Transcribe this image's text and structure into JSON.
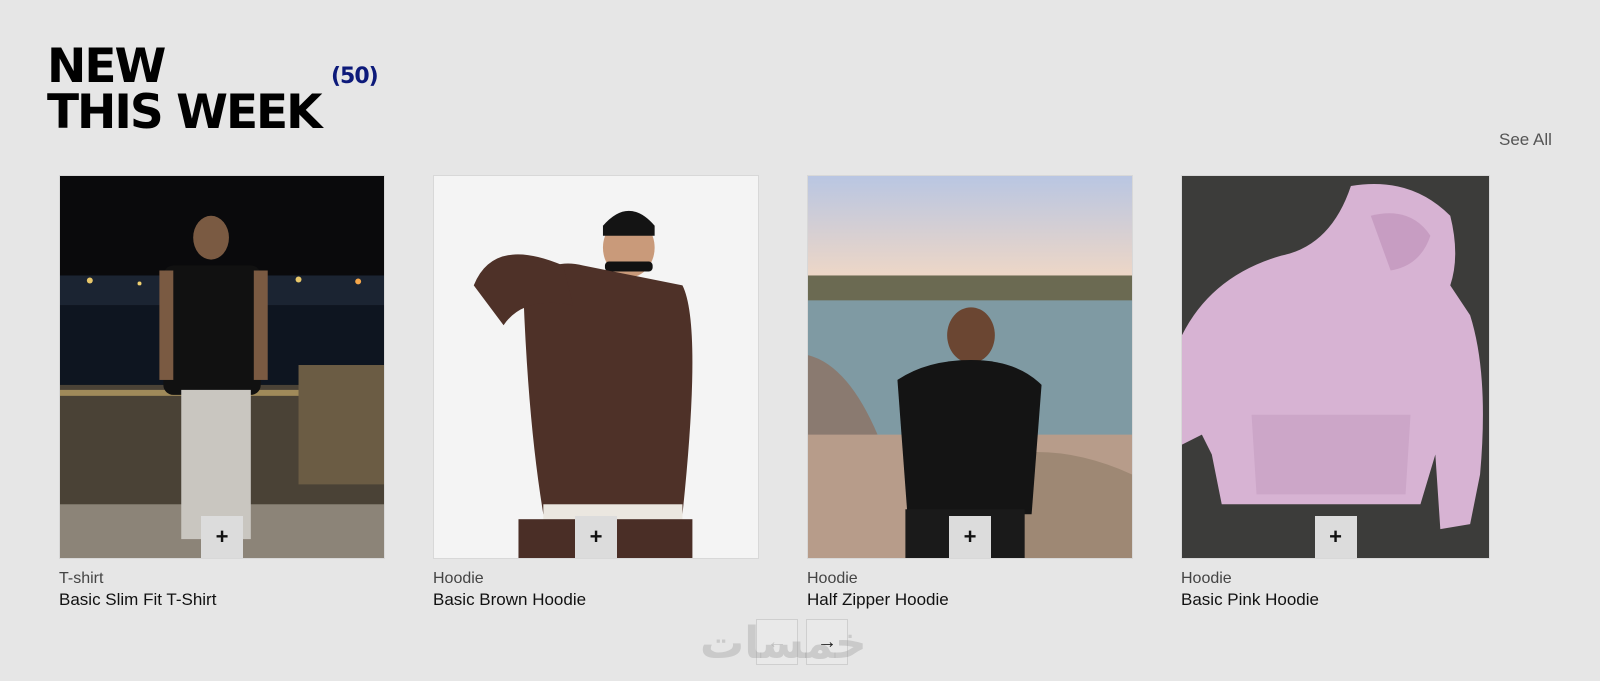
{
  "section": {
    "title_line1": "NEW",
    "title_line2": "THIS WEEK",
    "count": "(50)",
    "see_all": "See All"
  },
  "products": [
    {
      "category": "T-shirt",
      "name": "Basic Slim Fit T-Shirt",
      "add_label": "+"
    },
    {
      "category": "Hoodie",
      "name": "Basic Brown Hoodie",
      "add_label": "+"
    },
    {
      "category": "Hoodie",
      "name": "Half Zipper Hoodie",
      "add_label": "+"
    },
    {
      "category": "Hoodie",
      "name": "Basic Pink Hoodie",
      "add_label": "+"
    }
  ],
  "pagination": {
    "prev_icon": "arrow-left-icon",
    "next_icon": "arrow-right-icon",
    "prev_glyph": "←",
    "next_glyph": "→"
  },
  "watermark": "خمسات",
  "colors": {
    "background": "#e6e6e6",
    "count_accent": "#0d1a7a"
  }
}
